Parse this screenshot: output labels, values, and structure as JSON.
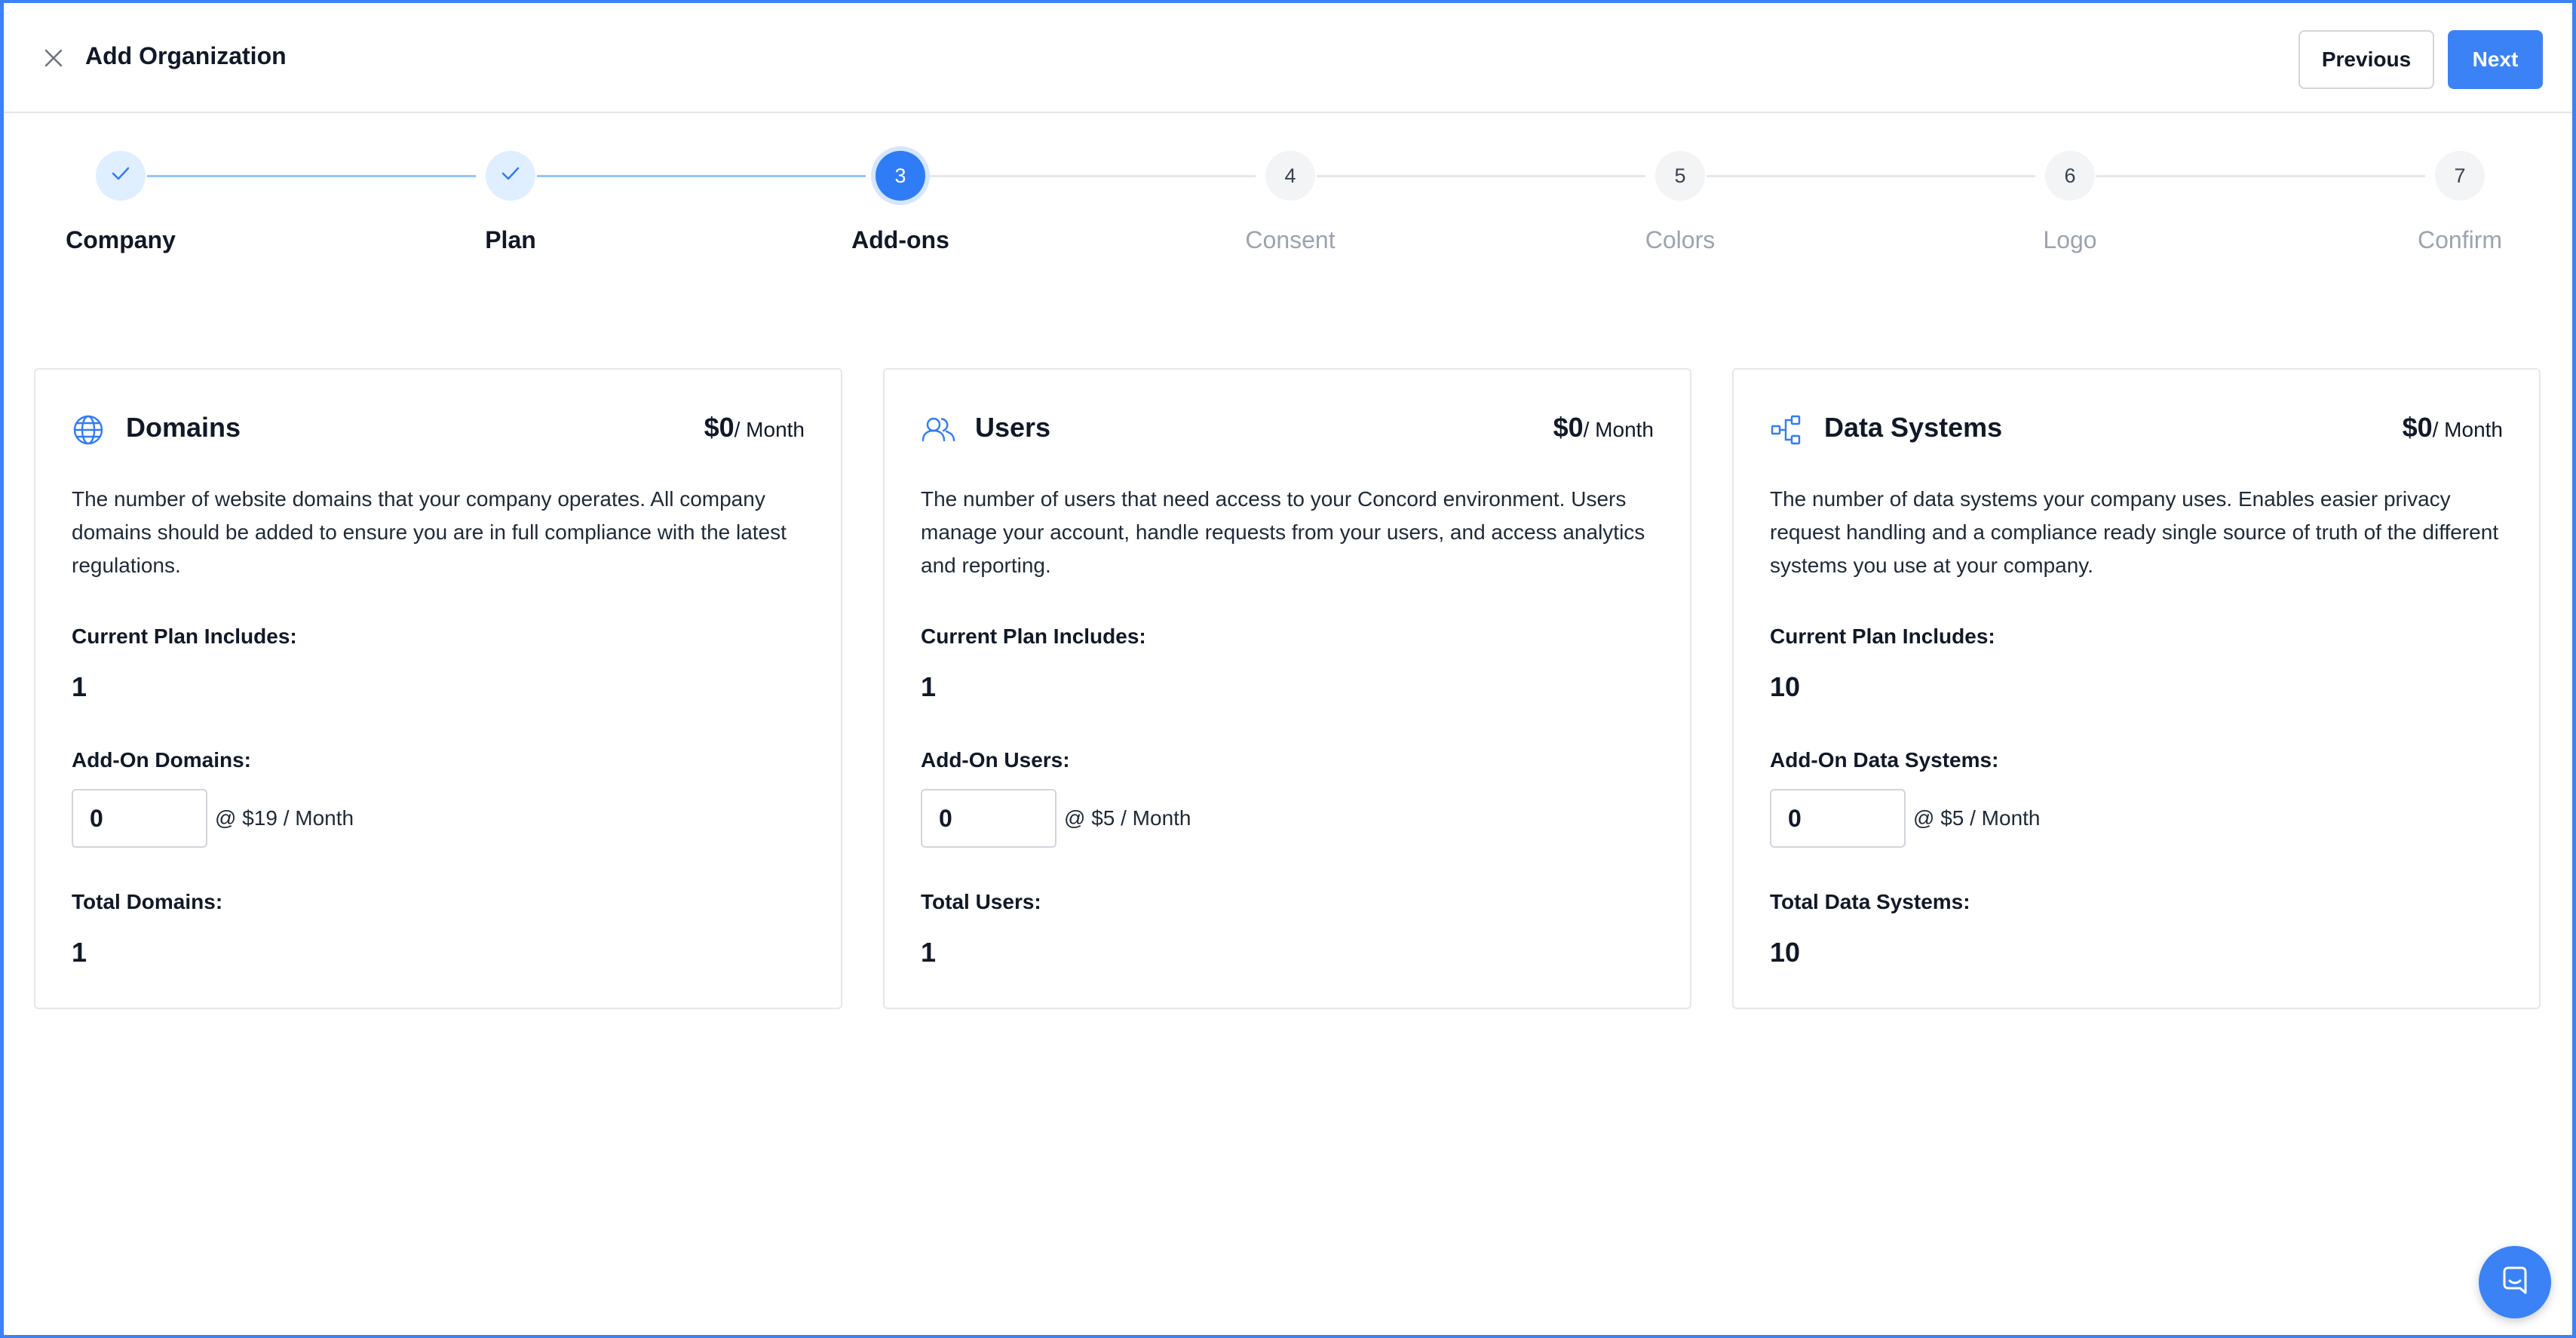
{
  "header": {
    "title": "Add Organization",
    "previous_label": "Previous",
    "next_label": "Next"
  },
  "stepper": {
    "steps": [
      {
        "number": "1",
        "label": "Company",
        "state": "done"
      },
      {
        "number": "2",
        "label": "Plan",
        "state": "done"
      },
      {
        "number": "3",
        "label": "Add-ons",
        "state": "active"
      },
      {
        "number": "4",
        "label": "Consent",
        "state": "upcoming"
      },
      {
        "number": "5",
        "label": "Colors",
        "state": "upcoming"
      },
      {
        "number": "6",
        "label": "Logo",
        "state": "upcoming"
      },
      {
        "number": "7",
        "label": "Confirm",
        "state": "upcoming"
      }
    ]
  },
  "cards": [
    {
      "icon": "globe-icon",
      "title": "Domains",
      "price": "$0",
      "price_unit": "/ Month",
      "description": "The number of website domains that your company operates. All company domains should be added to ensure you are in full compliance with the latest regulations.",
      "current_label": "Current Plan Includes:",
      "current_value": "1",
      "addon_label": "Add-On Domains:",
      "addon_value": "0",
      "addon_rate": "@ $19 / Month",
      "total_label": "Total Domains:",
      "total_value": "1"
    },
    {
      "icon": "users-icon",
      "title": "Users",
      "price": "$0",
      "price_unit": "/ Month",
      "description": "The number of users that need access to your Concord environment. Users manage your account, handle requests from your users, and access analytics and reporting.",
      "current_label": "Current Plan Includes:",
      "current_value": "1",
      "addon_label": "Add-On Users:",
      "addon_value": "0",
      "addon_rate": "@ $5 / Month",
      "total_label": "Total Users:",
      "total_value": "1"
    },
    {
      "icon": "data-systems-icon",
      "title": "Data Systems",
      "price": "$0",
      "price_unit": "/ Month",
      "description": "The number of data systems your company uses. Enables easier privacy request handling and a compliance ready single source of truth of the different systems you use at your company.",
      "current_label": "Current Plan Includes:",
      "current_value": "10",
      "addon_label": "Add-On Data Systems:",
      "addon_value": "0",
      "addon_rate": "@ $5 / Month",
      "total_label": "Total Data Systems:",
      "total_value": "10"
    }
  ],
  "colors": {
    "accent": "#3b82f6",
    "frame": "#3b82f6"
  },
  "chat": {
    "icon": "chat-icon"
  }
}
